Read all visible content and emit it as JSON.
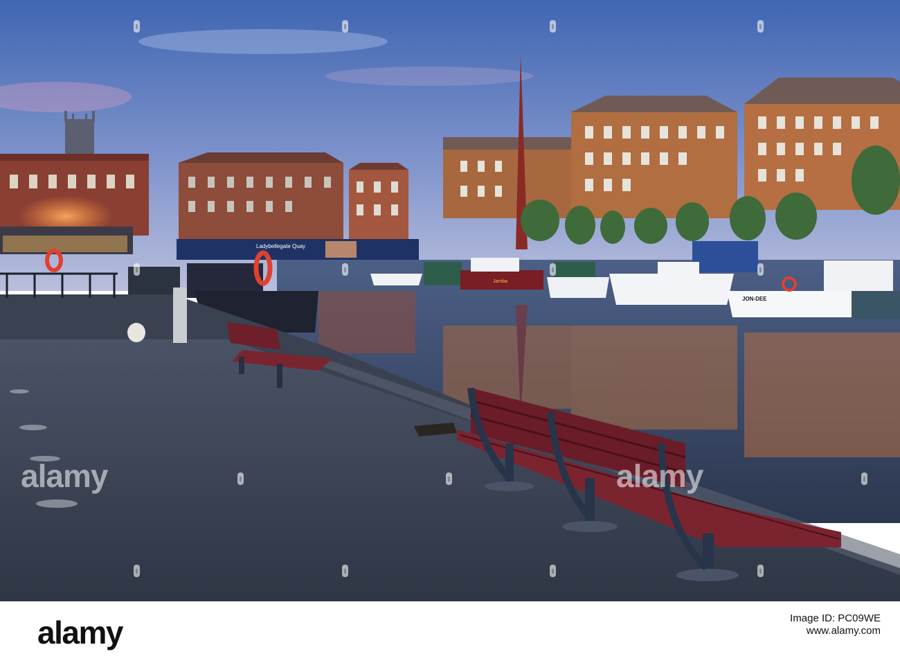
{
  "photo": {
    "scene": "Harbour quayside at dusk with benches, moored boats and brick buildings reflected in water",
    "colors": {
      "sky_top": "#4a6fb8",
      "sky_bottom": "#a9b5d8",
      "water": "#3a4a66",
      "pavement": "#3b4354",
      "bench": "#6e1f2a",
      "brick": "#a0603f"
    },
    "sign_title": "Ladybellegate Quay",
    "boat_name_1": "JON-DEE",
    "boat_name_2": "Jamba"
  },
  "watermark": {
    "text": "alamy",
    "symbol": "a"
  },
  "banner": {
    "logo": "alamy",
    "image_id_line": "Image ID: PC09WE",
    "site_line": "www.alamy.com"
  }
}
